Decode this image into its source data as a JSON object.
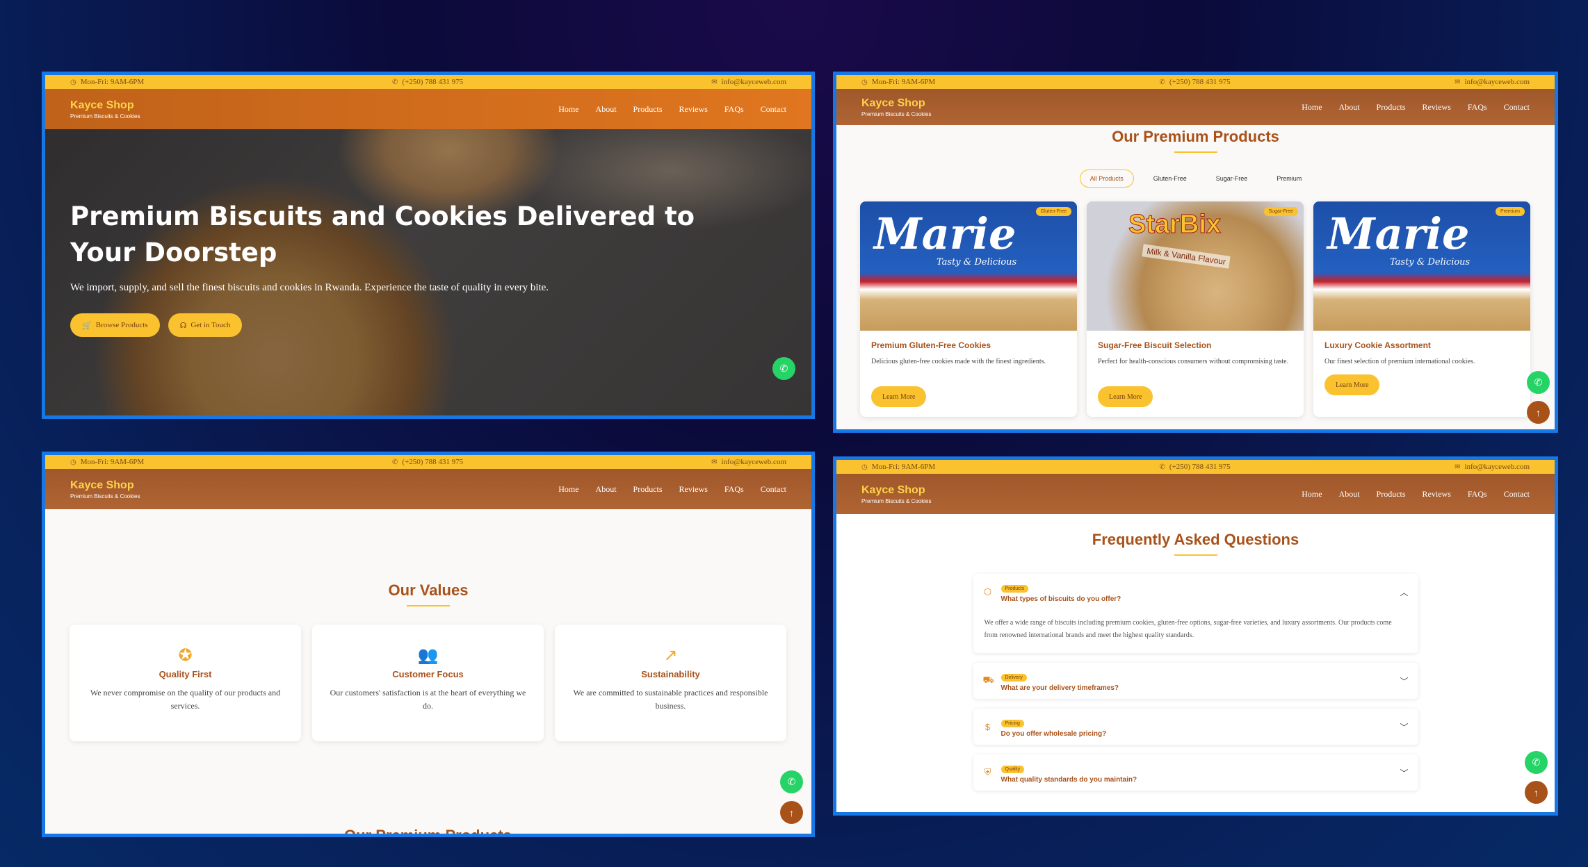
{
  "topbar": {
    "hours": "Mon-Fri: 9AM-6PM",
    "phone": "(+250) 788 431 975",
    "email": "info@kayceweb.com"
  },
  "brand": {
    "name": "Kayce Shop",
    "tagline": "Premium Biscuits & Cookies"
  },
  "nav": [
    "Home",
    "About",
    "Products",
    "Reviews",
    "FAQs",
    "Contact"
  ],
  "hero": {
    "title": "Premium Biscuits and Cookies Delivered to Your Doorstep",
    "subtitle": "We import, supply, and sell the finest biscuits and cookies in Rwanda. Experience the taste of quality in every bite.",
    "btn_browse": "Browse Products",
    "btn_contact": "Get in Touch"
  },
  "products": {
    "title": "Our Premium Products",
    "filters": [
      "All Products",
      "Gluten-Free",
      "Sugar-Free",
      "Premium"
    ],
    "items": [
      {
        "badge": "Gluten-Free",
        "brand_art": "Marie",
        "brand_sub": "Tasty & Delicious",
        "name": "Premium Gluten-Free Cookies",
        "desc": "Delicious gluten-free cookies made with the finest ingredients.",
        "cta": "Learn More"
      },
      {
        "badge": "Sugar-Free",
        "brand_art": "StarBix",
        "brand_sub": "Milk & Vanilla Flavour",
        "name": "Sugar-Free Biscuit Selection",
        "desc": "Perfect for health-conscious consumers without compromising taste.",
        "cta": "Learn More"
      },
      {
        "badge": "Premium",
        "brand_art": "Marie",
        "brand_sub": "Tasty & Delicious",
        "name": "Luxury Cookie Assortment",
        "desc": "Our finest selection of premium international cookies.",
        "cta": "Learn More"
      }
    ]
  },
  "values": {
    "title": "Our Values",
    "items": [
      {
        "icon": "award-icon",
        "title": "Quality First",
        "desc": "We never compromise on the quality of our products and services."
      },
      {
        "icon": "users-icon",
        "title": "Customer Focus",
        "desc": "Our customers' satisfaction is at the heart of everything we do."
      },
      {
        "icon": "trending-up-icon",
        "title": "Sustainability",
        "desc": "We are committed to sustainable practices and responsible business."
      }
    ],
    "next_section_heading": "Our Premium Products"
  },
  "faq": {
    "title": "Frequently Asked Questions",
    "items": [
      {
        "icon": "box-icon",
        "tag": "Products",
        "question": "What types of biscuits do you offer?",
        "answer": "We offer a wide range of biscuits including premium cookies, gluten-free options, sugar-free varieties, and luxury assortments. Our products come from renowned international brands and meet the highest quality standards.",
        "expanded": true
      },
      {
        "icon": "truck-icon",
        "tag": "Delivery",
        "question": "What are your delivery timeframes?",
        "expanded": false
      },
      {
        "icon": "dollar-icon",
        "tag": "Pricing",
        "question": "Do you offer wholesale pricing?",
        "expanded": false
      },
      {
        "icon": "shield-icon",
        "tag": "Quality",
        "question": "What quality standards do you maintain?",
        "expanded": false
      }
    ]
  },
  "colors": {
    "accent_yellow": "#f9c22e",
    "brand_brown": "#a8521a",
    "whatsapp_green": "#25d366",
    "frame_blue": "#1677e5"
  }
}
